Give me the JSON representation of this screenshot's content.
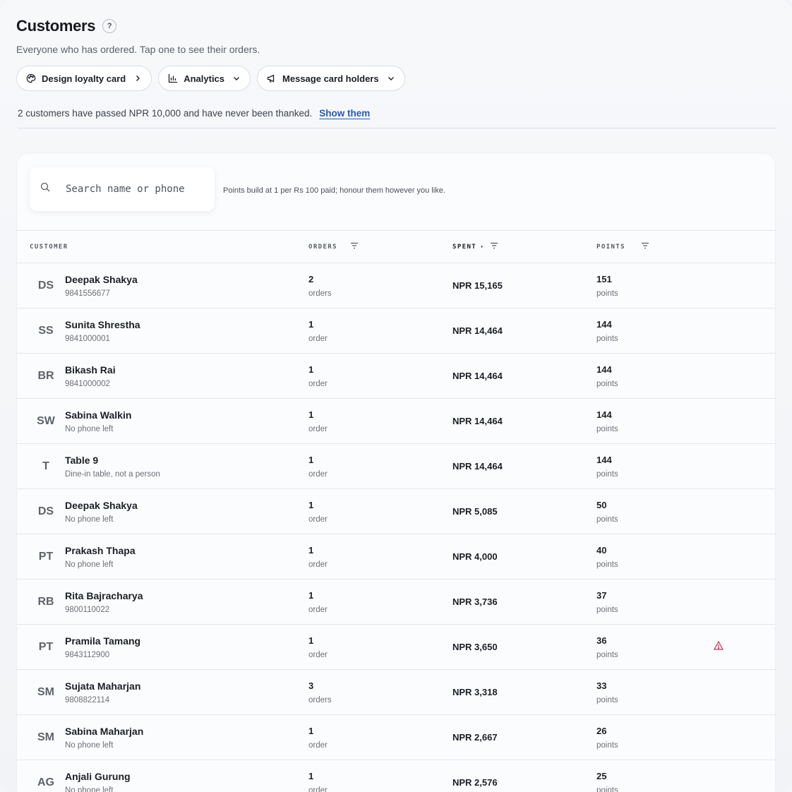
{
  "header": {
    "title": "Customers",
    "help_label": "?",
    "subtitle": "Everyone who has ordered. Tap one to see their orders."
  },
  "actions": {
    "design_loyalty": "Design loyalty card",
    "analytics": "Analytics",
    "message_holders": "Message card holders"
  },
  "notice": {
    "text": "2 customers have passed NPR 10,000 and have never been thanked.",
    "link": "Show them"
  },
  "search": {
    "placeholder": "Search name or phone",
    "hint": "Points build at 1 per Rs 100 paid; honour them however you like."
  },
  "table": {
    "columns": {
      "customer": "CUSTOMER",
      "orders": "ORDERS",
      "spent": "SPENT",
      "spent_sort": "▾",
      "points": "POINTS"
    },
    "rows": [
      {
        "initials": "DS",
        "name": "Deepak Shakya",
        "sub": "9841556677",
        "orders": "2",
        "orders_unit": "orders",
        "spent": "NPR 15,165",
        "points": "151",
        "points_unit": "points",
        "warning": false
      },
      {
        "initials": "SS",
        "name": "Sunita Shrestha",
        "sub": "9841000001",
        "orders": "1",
        "orders_unit": "order",
        "spent": "NPR 14,464",
        "points": "144",
        "points_unit": "points",
        "warning": false
      },
      {
        "initials": "BR",
        "name": "Bikash Rai",
        "sub": "9841000002",
        "orders": "1",
        "orders_unit": "order",
        "spent": "NPR 14,464",
        "points": "144",
        "points_unit": "points",
        "warning": false
      },
      {
        "initials": "SW",
        "name": "Sabina Walkin",
        "sub": "No phone left",
        "orders": "1",
        "orders_unit": "order",
        "spent": "NPR 14,464",
        "points": "144",
        "points_unit": "points",
        "warning": false
      },
      {
        "initials": "T",
        "name": "Table 9",
        "sub": "Dine-in table, not a person",
        "orders": "1",
        "orders_unit": "order",
        "spent": "NPR 14,464",
        "points": "144",
        "points_unit": "points",
        "warning": false
      },
      {
        "initials": "DS",
        "name": "Deepak Shakya",
        "sub": "No phone left",
        "orders": "1",
        "orders_unit": "order",
        "spent": "NPR 5,085",
        "points": "50",
        "points_unit": "points",
        "warning": false
      },
      {
        "initials": "PT",
        "name": "Prakash Thapa",
        "sub": "No phone left",
        "orders": "1",
        "orders_unit": "order",
        "spent": "NPR 4,000",
        "points": "40",
        "points_unit": "points",
        "warning": false
      },
      {
        "initials": "RB",
        "name": "Rita Bajracharya",
        "sub": "9800110022",
        "orders": "1",
        "orders_unit": "order",
        "spent": "NPR 3,736",
        "points": "37",
        "points_unit": "points",
        "warning": false
      },
      {
        "initials": "PT",
        "name": "Pramila Tamang",
        "sub": "9843112900",
        "orders": "1",
        "orders_unit": "order",
        "spent": "NPR 3,650",
        "points": "36",
        "points_unit": "points",
        "warning": true
      },
      {
        "initials": "SM",
        "name": "Sujata Maharjan",
        "sub": "9808822114",
        "orders": "3",
        "orders_unit": "orders",
        "spent": "NPR 3,318",
        "points": "33",
        "points_unit": "points",
        "warning": false
      },
      {
        "initials": "SM",
        "name": "Sabina Maharjan",
        "sub": "No phone left",
        "orders": "1",
        "orders_unit": "order",
        "spent": "NPR 2,667",
        "points": "26",
        "points_unit": "points",
        "warning": false
      },
      {
        "initials": "AG",
        "name": "Anjali Gurung",
        "sub": "No phone left",
        "orders": "1",
        "orders_unit": "order",
        "spent": "NPR 2,576",
        "points": "25",
        "points_unit": "points",
        "warning": false
      }
    ]
  },
  "colors": {
    "link": "#2459b8",
    "warning": "#c8304a"
  }
}
